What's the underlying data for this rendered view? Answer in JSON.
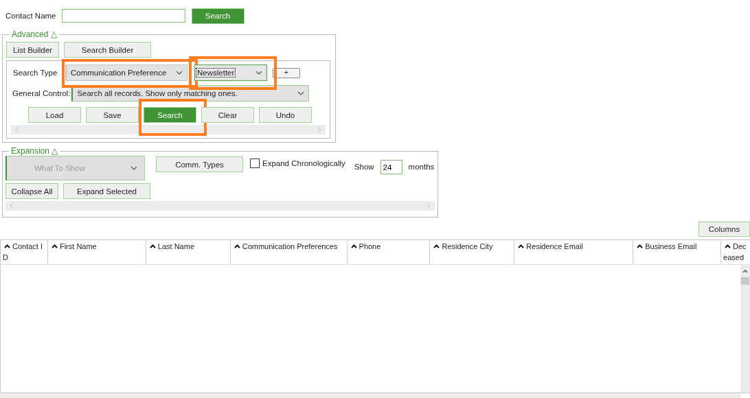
{
  "contact_search": {
    "label": "Contact Name",
    "button": "Search"
  },
  "advanced": {
    "legend": "Advanced △",
    "builders": [
      "List Builder",
      "Search Builder"
    ],
    "search_type": {
      "label": "Search Type",
      "selects": [
        {
          "value": "Communication Preference",
          "highlighted": true,
          "focused": false
        },
        {
          "value": "Newsletter",
          "highlighted": true,
          "focused": true
        }
      ],
      "add_button": "+"
    },
    "general_control": {
      "label": "General Control:",
      "value": "Search all records. Show only matching ones."
    },
    "actions": [
      {
        "label": "Load",
        "primary": false,
        "highlighted": false
      },
      {
        "label": "Save",
        "primary": false,
        "highlighted": false
      },
      {
        "label": "Search",
        "primary": true,
        "highlighted": true
      },
      {
        "label": "Clear",
        "primary": false,
        "highlighted": false
      },
      {
        "label": "Undo",
        "primary": false,
        "highlighted": false
      }
    ]
  },
  "expansion": {
    "legend": "Expansion △",
    "what_to_show": {
      "placeholder": "What To Show",
      "disabled": true
    },
    "comm_types": "Comm. Types",
    "expand_chronologically": {
      "label": "Expand Chronologically",
      "checked": false
    },
    "show_label": "Show",
    "months_value": "24",
    "months_label": "months",
    "buttons": [
      "Collapse All",
      "Expand Selected"
    ]
  },
  "columns_button": "Columns",
  "table": {
    "columns": [
      "Contact ID",
      "First Name",
      "Last Name",
      "Communication Preferences",
      "Phone",
      "Residence City",
      "Residence Email",
      "Business Email",
      "Deceased"
    ]
  }
}
